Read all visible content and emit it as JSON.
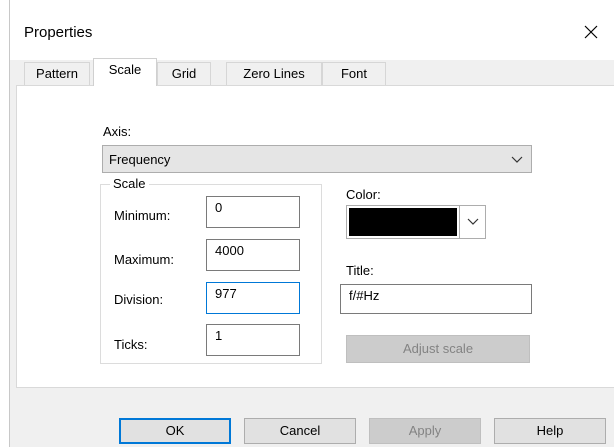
{
  "window": {
    "title": "Properties",
    "close_icon": "close-icon"
  },
  "tabs": [
    {
      "label": "Pattern",
      "active": false
    },
    {
      "label": "Scale",
      "active": true
    },
    {
      "label": "Grid",
      "active": false
    },
    {
      "label": "Zero Lines",
      "active": false
    },
    {
      "label": "Font",
      "active": false
    }
  ],
  "axis": {
    "label": "Axis:",
    "value": "Frequency"
  },
  "scale_group": {
    "title": "Scale",
    "minimum": {
      "label": "Minimum:",
      "value": "0"
    },
    "maximum": {
      "label": "Maximum:",
      "value": "4000"
    },
    "division": {
      "label": "Division:",
      "value": "977"
    },
    "ticks": {
      "label": "Ticks:",
      "value": "1"
    }
  },
  "color": {
    "label": "Color:",
    "value": "#000000"
  },
  "title_field": {
    "label": "Title:",
    "value": "f/#Hz"
  },
  "adjust_scale": {
    "label": "Adjust scale",
    "enabled": false
  },
  "footer": {
    "ok": "OK",
    "cancel": "Cancel",
    "apply": "Apply",
    "help": "Help"
  }
}
